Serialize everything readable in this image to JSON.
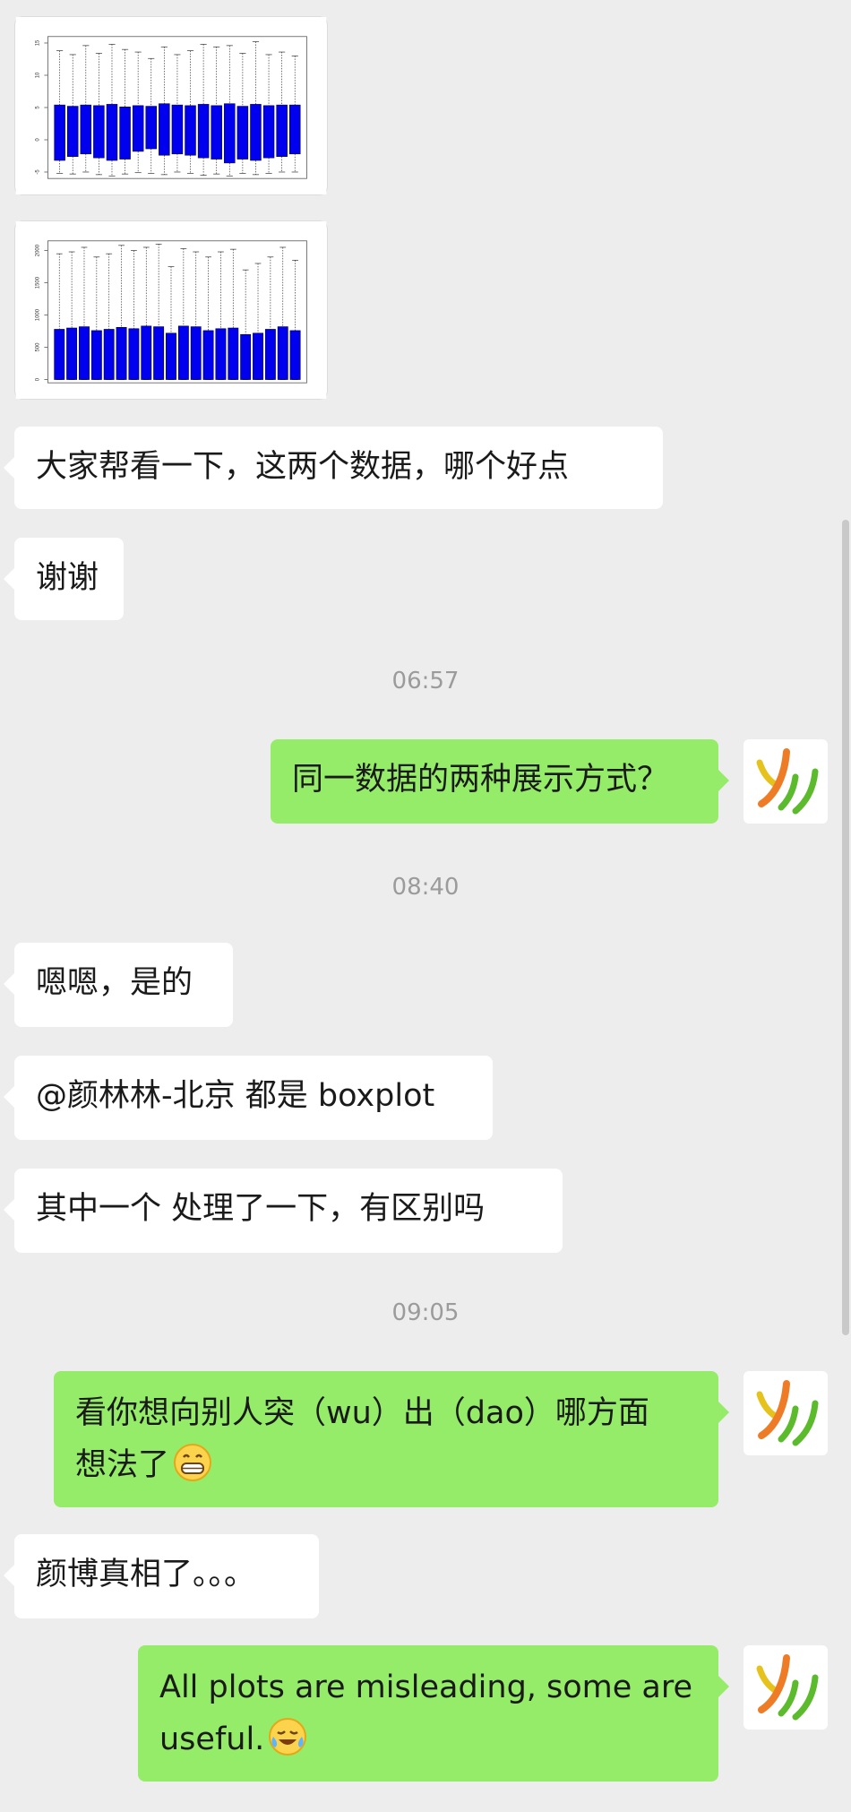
{
  "chat": {
    "messages": [
      {
        "text": "大家帮看一下，这两个数据，哪个好点"
      },
      {
        "text": "谢谢"
      },
      {
        "text": "同一数据的两种展示方式？"
      },
      {
        "text": "嗯嗯，是的"
      },
      {
        "text": "@颜林林-北京  都是 boxplot"
      },
      {
        "text": "其中一个 处理了一下，有区别吗"
      },
      {
        "text_line1": "看你想向别人突（wu）出（dao）哪方面",
        "text_line2": "想法了",
        "emoji": "grinning-face-emoji"
      },
      {
        "text": "颜博真相了。。。"
      },
      {
        "text_line1": "All plots are misleading, some are",
        "text_line2": "useful.",
        "emoji": "crying-laughing-emoji"
      }
    ],
    "timestamps": [
      "06:57",
      "08:40",
      "09:05"
    ]
  },
  "chart_data": [
    {
      "type": "box",
      "y_ticks": [
        "-5",
        "0",
        "5",
        "10",
        "15"
      ],
      "ylim": [
        -6,
        16
      ],
      "box_color": "#0000ee",
      "boxes": [
        {
          "q1": -3.2,
          "q3": 5.4,
          "min": -5.2,
          "max": 13.8
        },
        {
          "q1": -2.6,
          "q3": 5.2,
          "min": -5.3,
          "max": 13.2
        },
        {
          "q1": -2.2,
          "q3": 5.4,
          "min": -5.0,
          "max": 14.6
        },
        {
          "q1": -2.8,
          "q3": 5.3,
          "min": -5.4,
          "max": 13.4
        },
        {
          "q1": -3.2,
          "q3": 5.5,
          "min": -5.6,
          "max": 14.8
        },
        {
          "q1": -3.0,
          "q3": 5.1,
          "min": -5.3,
          "max": 14.0
        },
        {
          "q1": -1.8,
          "q3": 5.3,
          "min": -5.1,
          "max": 13.6
        },
        {
          "q1": -1.4,
          "q3": 5.2,
          "min": -5.2,
          "max": 12.6
        },
        {
          "q1": -2.4,
          "q3": 5.6,
          "min": -5.4,
          "max": 14.4
        },
        {
          "q1": -2.2,
          "q3": 5.4,
          "min": -5.0,
          "max": 13.2
        },
        {
          "q1": -2.4,
          "q3": 5.3,
          "min": -5.2,
          "max": 13.8
        },
        {
          "q1": -2.8,
          "q3": 5.5,
          "min": -5.5,
          "max": 14.8
        },
        {
          "q1": -3.0,
          "q3": 5.3,
          "min": -5.3,
          "max": 14.4
        },
        {
          "q1": -3.6,
          "q3": 5.6,
          "min": -5.6,
          "max": 14.6
        },
        {
          "q1": -3.0,
          "q3": 5.2,
          "min": -5.2,
          "max": 13.4
        },
        {
          "q1": -3.2,
          "q3": 5.5,
          "min": -5.4,
          "max": 15.2
        },
        {
          "q1": -2.8,
          "q3": 5.3,
          "min": -5.2,
          "max": 13.2
        },
        {
          "q1": -2.6,
          "q3": 5.4,
          "min": -5.0,
          "max": 13.6
        },
        {
          "q1": -2.2,
          "q3": 5.4,
          "min": -5.0,
          "max": 13.0
        }
      ]
    },
    {
      "type": "box",
      "y_ticks": [
        "0",
        "500",
        "1000",
        "1500",
        "2000"
      ],
      "ylim": [
        -50,
        2150
      ],
      "box_color": "#0000ee",
      "boxes": [
        {
          "q1": 0,
          "q3": 780,
          "min": 0,
          "max": 1950
        },
        {
          "q1": 0,
          "q3": 800,
          "min": 0,
          "max": 1980
        },
        {
          "q1": 0,
          "q3": 820,
          "min": 0,
          "max": 2050
        },
        {
          "q1": 0,
          "q3": 760,
          "min": 0,
          "max": 1900
        },
        {
          "q1": 0,
          "q3": 780,
          "min": 0,
          "max": 1950
        },
        {
          "q1": 0,
          "q3": 810,
          "min": 0,
          "max": 2080
        },
        {
          "q1": 0,
          "q3": 790,
          "min": 0,
          "max": 2000
        },
        {
          "q1": 0,
          "q3": 830,
          "min": 0,
          "max": 2050
        },
        {
          "q1": 0,
          "q3": 820,
          "min": 0,
          "max": 2100
        },
        {
          "q1": 0,
          "q3": 720,
          "min": 0,
          "max": 1750
        },
        {
          "q1": 0,
          "q3": 830,
          "min": 0,
          "max": 2030
        },
        {
          "q1": 0,
          "q3": 820,
          "min": 0,
          "max": 1980
        },
        {
          "q1": 0,
          "q3": 760,
          "min": 0,
          "max": 1900
        },
        {
          "q1": 0,
          "q3": 790,
          "min": 0,
          "max": 1980
        },
        {
          "q1": 0,
          "q3": 800,
          "min": 0,
          "max": 2020
        },
        {
          "q1": 0,
          "q3": 700,
          "min": 0,
          "max": 1700
        },
        {
          "q1": 0,
          "q3": 720,
          "min": 0,
          "max": 1800
        },
        {
          "q1": 0,
          "q3": 780,
          "min": 0,
          "max": 1900
        },
        {
          "q1": 0,
          "q3": 820,
          "min": 0,
          "max": 2050
        },
        {
          "q1": 0,
          "q3": 760,
          "min": 0,
          "max": 1850
        }
      ]
    }
  ]
}
